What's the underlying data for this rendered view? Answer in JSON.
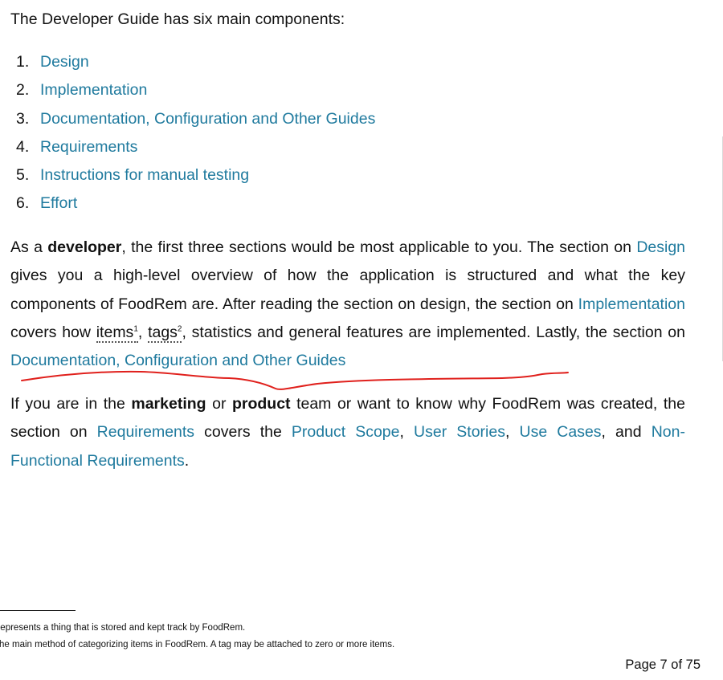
{
  "intro": "The Developer Guide has six main components:",
  "toc": [
    {
      "num": "1.",
      "label": "Design"
    },
    {
      "num": "2.",
      "label": "Implementation"
    },
    {
      "num": "3.",
      "label": "Documentation, Configuration and Other Guides"
    },
    {
      "num": "4.",
      "label": "Requirements"
    },
    {
      "num": "5.",
      "label": "Instructions for manual testing"
    },
    {
      "num": "6.",
      "label": "Effort"
    }
  ],
  "para1": {
    "t1": "As a ",
    "b1": "developer",
    "t2": ", the first three sections would be most applicable to you. The section on ",
    "l1": "Design",
    "t3": " gives you a high-level overview of how the application is structured and what the key components of FoodRem are. After reading the section on design, the section on ",
    "l2": "Implementation",
    "t4": " covers how ",
    "r1": "items",
    "sup1": "1",
    "t5": ", ",
    "r2": "tags",
    "sup2": "2",
    "t6": ", statistics and general features are implemented. Lastly, the section on ",
    "l3": "Documentation, Configuration and Other Guides"
  },
  "para2": {
    "t1": "If you are in the ",
    "b1": "marketing",
    "t2": " or ",
    "b2": "product",
    "t3": " team or want to know why FoodRem was created, the section on ",
    "l1": "Requirements",
    "t4": " covers the ",
    "l2": "Product Scope",
    "t5": ", ",
    "l3": "User Stories",
    "t6": ", ",
    "l4": "Use Cases",
    "t7": ", and ",
    "l5": "Non-Functional Requirements",
    "t8": "."
  },
  "footnotes": [
    "Represents a thing that is stored and kept track by FoodRem.",
    "The main method of categorizing items in FoodRem. A tag may be attached to zero or more items."
  ],
  "page_number": "Page 7 of 75",
  "colors": {
    "link": "#1f7a9e",
    "annotation": "#e0201c"
  }
}
